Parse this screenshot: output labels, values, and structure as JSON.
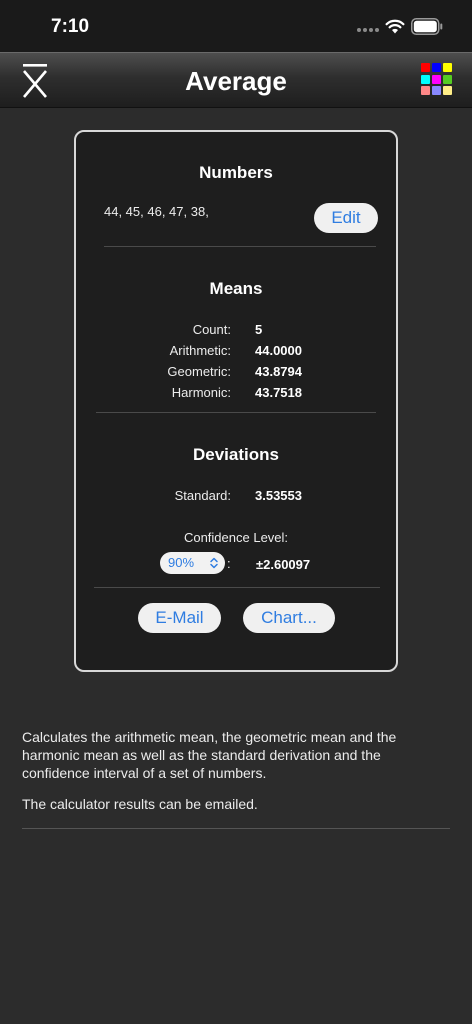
{
  "status_bar": {
    "time": "7:10"
  },
  "nav": {
    "title": "Average",
    "grid_colors": [
      "#ff0000",
      "#0000ff",
      "#ffff00",
      "#00ffff",
      "#ff00ff",
      "#55cc22",
      "#ff8888",
      "#8888ff",
      "#ffee88"
    ]
  },
  "numbers": {
    "title": "Numbers",
    "list": "44, 45, 46, 47, 38,",
    "edit_label": "Edit"
  },
  "means": {
    "title": "Means",
    "rows": [
      {
        "label": "Count:",
        "value": "5"
      },
      {
        "label": "Arithmetic:",
        "value": "44.0000"
      },
      {
        "label": "Geometric:",
        "value": "43.8794"
      },
      {
        "label": "Harmonic:",
        "value": "43.7518"
      }
    ]
  },
  "deviations": {
    "title": "Deviations",
    "standard_label": "Standard:",
    "standard_value": "3.53553",
    "confidence_label": "Confidence Level:",
    "confidence_selected": "90%",
    "confidence_colon": ":",
    "confidence_value": "±2.60097"
  },
  "actions": {
    "email_label": "E-Mail",
    "chart_label": "Chart..."
  },
  "description": {
    "paragraph1": "Calculates the arithmetic mean, the geometric mean and the harmonic mean as well as the standard derivation and the confidence interval of a set of numbers.",
    "paragraph2": "The calculator results can be emailed."
  },
  "colors": {
    "accent": "#2f7de1",
    "background": "#2c2c2c",
    "card": "#1e1e1e"
  }
}
